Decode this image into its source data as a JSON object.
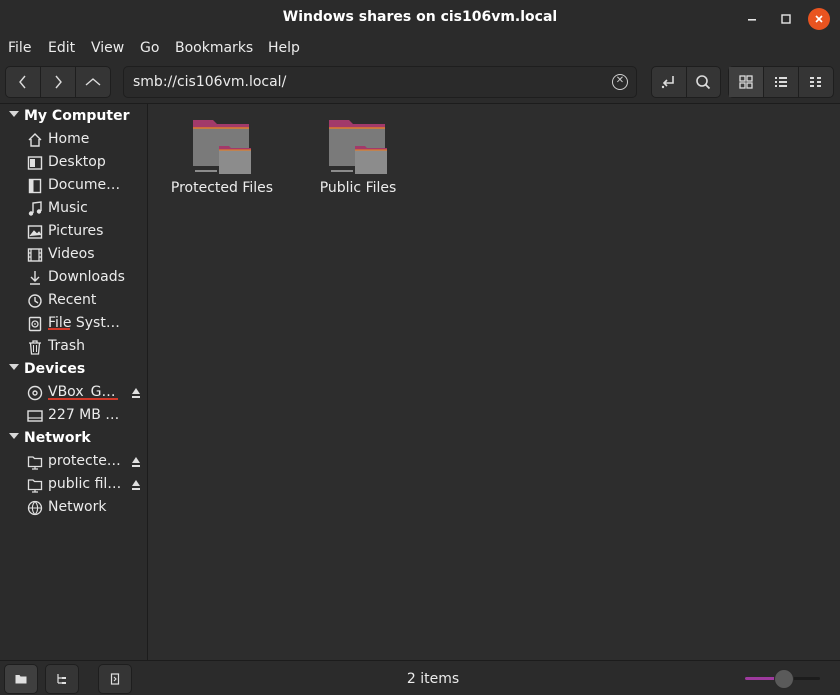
{
  "window": {
    "title": "Windows shares on cis106vm.local"
  },
  "menu": [
    "File",
    "Edit",
    "View",
    "Go",
    "Bookmarks",
    "Help"
  ],
  "location": {
    "path": "smb://cis106vm.local/"
  },
  "sidebar": {
    "sections": [
      {
        "title": "My Computer",
        "items": [
          {
            "label": "Home",
            "icon": "home-icon"
          },
          {
            "label": "Desktop",
            "icon": "desktop-icon"
          },
          {
            "label": "Docume…",
            "icon": "documents-icon"
          },
          {
            "label": "Music",
            "icon": "music-icon"
          },
          {
            "label": "Pictures",
            "icon": "pictures-icon"
          },
          {
            "label": "Videos",
            "icon": "videos-icon"
          },
          {
            "label": "Downloads",
            "icon": "downloads-icon"
          },
          {
            "label": "Recent",
            "icon": "recent-icon"
          },
          {
            "label": "File Syst…",
            "icon": "filesystem-icon"
          },
          {
            "label": "Trash",
            "icon": "trash-icon"
          }
        ]
      },
      {
        "title": "Devices",
        "items": [
          {
            "label": "VBox_G…",
            "icon": "optical-disc-icon",
            "eject": true
          },
          {
            "label": "227 MB …",
            "icon": "drive-icon",
            "eject": false
          }
        ]
      },
      {
        "title": "Network",
        "items": [
          {
            "label": "protecte…",
            "icon": "network-folder-icon",
            "eject": true
          },
          {
            "label": "public fil…",
            "icon": "network-folder-icon",
            "eject": true
          },
          {
            "label": "Network",
            "icon": "network-icon",
            "eject": false
          }
        ]
      }
    ]
  },
  "files": [
    {
      "name": "Protected Files",
      "icon": "network-share-folder-icon"
    },
    {
      "name": "Public Files",
      "icon": "network-share-folder-icon"
    }
  ],
  "status": {
    "count": "2 items",
    "zoom": 0.52
  },
  "colors": {
    "accent": "#e95420",
    "folder_tab": "#a23a6a",
    "folder_body": "#7a7a7a",
    "slider_fill": "#9e3a9e"
  }
}
